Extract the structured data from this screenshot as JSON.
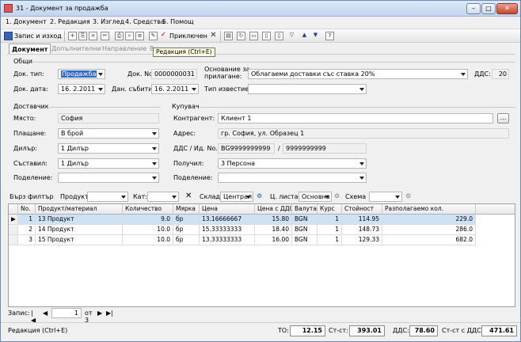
{
  "window": {
    "title": "31 - Документ за продажба"
  },
  "menu": [
    "1. Документ",
    "2. Редакция",
    "3. Изглед",
    "4. Средства",
    "5. Помощ"
  ],
  "toolbar": {
    "save_close": "Запис и изход",
    "accepted": "Приключен",
    "tooltip": "Редакция (Ctrl+E)"
  },
  "tabs": [
    "Документ",
    "Допълнителни",
    "Направление",
    "В"
  ],
  "general": {
    "section": "Общи",
    "doc_type_label": "Док. тип:",
    "doc_type": "Продажба",
    "doc_no_label": "Док. No.",
    "doc_no": "0000000031",
    "reason_label": "Основание за прилагане:",
    "reason": "Облагаеми доставки със ставка 20%",
    "vat_label": "ДДС:",
    "vat": "20",
    "doc_date_label": "Док. дата:",
    "doc_date": "16.  2.2011",
    "tax_date_label": "Дан. събитие:",
    "tax_date": "16.  2.2011",
    "notice_label": "Тип известие:",
    "notice": ""
  },
  "supplier": {
    "section": "Доставчик",
    "place_label": "Място:",
    "place": "София",
    "payment_label": "Плащане:",
    "payment": "В брой",
    "dealer_label": "Дилър:",
    "dealer": "1 Дилър",
    "author_label": "Съставил:",
    "author": "1 Дилър",
    "dept_label": "Поделение:",
    "dept": ""
  },
  "buyer": {
    "section": "Купувач",
    "partner_label": "Контрагент:",
    "partner": "Клиент 1",
    "browse": "...",
    "address_label": "Адрес:",
    "address": "гр. София, ул. Образец 1",
    "vatid_label": "ДДС / Ид. No.",
    "vat_no": "BG9999999999",
    "id_sep": "/",
    "id_no": "9999999999",
    "received_label": "Получил:",
    "received": "3 Персона",
    "dept_label": "Поделение:",
    "dept": ""
  },
  "filter": {
    "quick": "Бърз филтър",
    "product": "Продукт:",
    "category": "Кат:",
    "warehouse_label": "Склад",
    "warehouse": "Централ",
    "pricelist_label": "Ц. листа",
    "pricelist": "Основна",
    "scheme_label": "Схема"
  },
  "grid": {
    "columns": [
      "No.",
      "Продукт/материал",
      "Количество",
      "Мярка",
      "Цена",
      "Цена с ДДС",
      "Валута",
      "Курс",
      "Стойност",
      "Разполагаемо кол."
    ],
    "rows": [
      [
        "1",
        "13 Продукт",
        "9.0",
        "бр",
        "13.16666667",
        "15.80",
        "BGN",
        "1",
        "114.95",
        "229.0"
      ],
      [
        "2",
        "14 Продукт",
        "10.0",
        "бр",
        "15.33333333",
        "18.40",
        "BGN",
        "1",
        "148.73",
        "286.0"
      ],
      [
        "3",
        "15 Продукт",
        "10.0",
        "бр",
        "13.33333333",
        "16.00",
        "BGN",
        "1",
        "129.33",
        "682.0"
      ]
    ]
  },
  "navigator": {
    "label": "Запис:",
    "current": "1",
    "of": "от 3"
  },
  "status": {
    "hint": "Редакция (Ctrl+E)",
    "to_label": "ТО:",
    "to": "12.15",
    "cost_label": "Ст-ст:",
    "cost": "393.01",
    "vat_label": "ДДС:",
    "vat": "78.60",
    "cost_vat_label": "Ст-ст с ДДС:",
    "cost_vat": "471.61"
  }
}
